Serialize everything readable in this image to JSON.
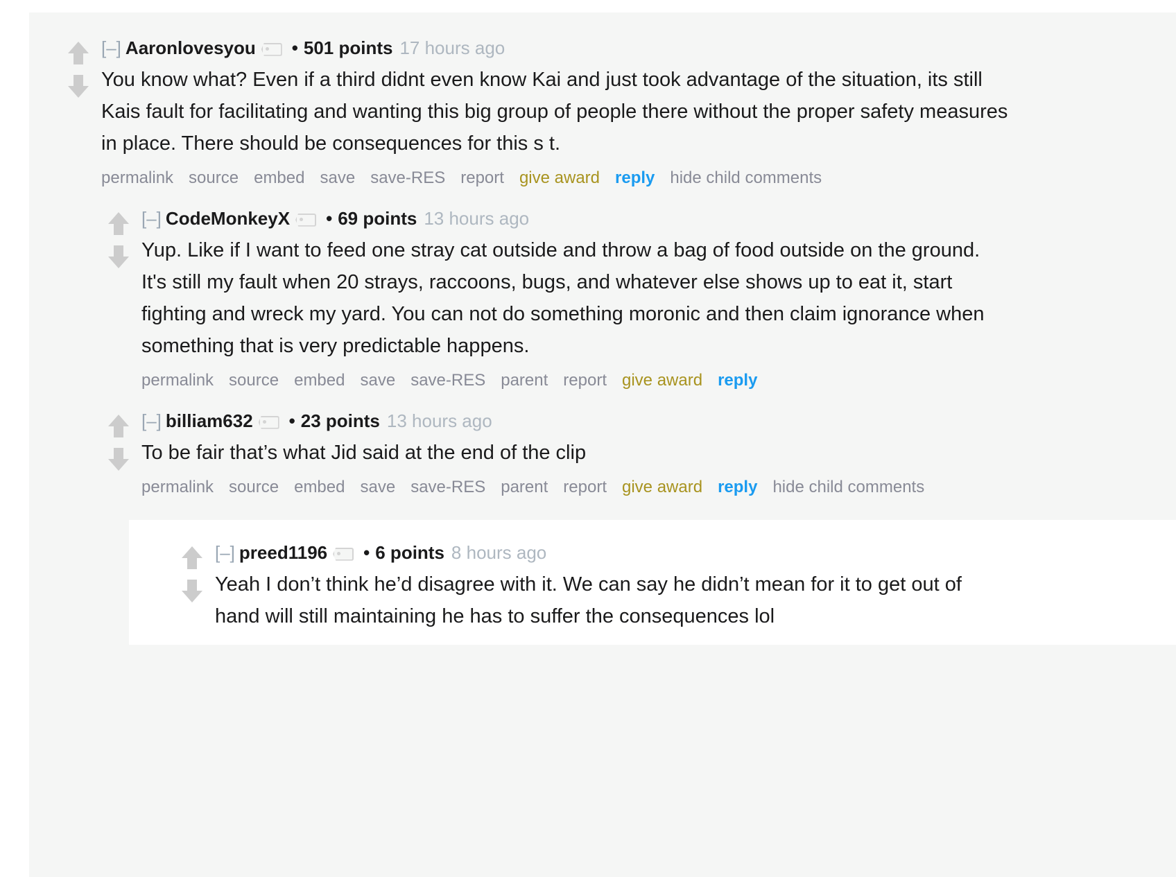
{
  "theme": {
    "page_background": "#ffffff",
    "panel_background": "#f5f6f5",
    "nested_card_background": "#ffffff",
    "text_color": "#1a1a1b",
    "muted_link_color": "#888a96",
    "timestamp_color": "#aeb7c0",
    "collapse_toggle_color": "#9aa7b4",
    "give_award_color": "#a8931f",
    "reply_color": "#1a9bf0",
    "vote_arrow_color": "#cccccc"
  },
  "icons": {
    "upvote": "upvote-arrow-icon",
    "downvote": "downvote-arrow-icon",
    "flair_tag": "user-flair-tag-icon"
  },
  "comments": [
    {
      "level": 0,
      "collapse_toggle": "[–]",
      "author": "Aaronlovesyou",
      "separator": "•",
      "points": "501 points",
      "timestamp": "17 hours ago",
      "body": "You know what? Even if a third didnt even know Kai and just took advantage of the situation, its still Kais fault for facilitating and wanting this big group of people there without the proper safety measures in place. There should be consequences for this s   t.",
      "actions": [
        "permalink",
        "source",
        "embed",
        "save",
        "save-RES",
        "report",
        "give award",
        "reply",
        "hide child comments"
      ]
    },
    {
      "level": 1,
      "collapse_toggle": "[–]",
      "author": "CodeMonkeyX",
      "separator": "•",
      "points": "69 points",
      "timestamp": "13 hours ago",
      "body": "Yup. Like if I want to feed one stray cat outside and throw a bag of food outside on the ground. It's still my fault when 20 strays, raccoons, bugs, and whatever else shows up to eat it, start fighting and wreck my yard. You can not do something moronic and then claim ignorance when something that is very predictable happens.",
      "actions": [
        "permalink",
        "source",
        "embed",
        "save",
        "save-RES",
        "parent",
        "report",
        "give award",
        "reply"
      ]
    },
    {
      "level": 2,
      "collapse_toggle": "[–]",
      "author": "billiam632",
      "separator": "•",
      "points": "23 points",
      "timestamp": "13 hours ago",
      "body": "To be fair that’s what Jid said at the end of the clip",
      "actions": [
        "permalink",
        "source",
        "embed",
        "save",
        "save-RES",
        "parent",
        "report",
        "give award",
        "reply",
        "hide child comments"
      ]
    },
    {
      "level": 3,
      "collapse_toggle": "[–]",
      "author": "preed1196",
      "separator": "•",
      "points": "6 points",
      "timestamp": "8 hours ago",
      "body": "Yeah I don’t think he’d disagree with it. We can say he didn’t mean for it to get out of hand will still maintaining he has to suffer the consequences lol",
      "actions": []
    }
  ]
}
